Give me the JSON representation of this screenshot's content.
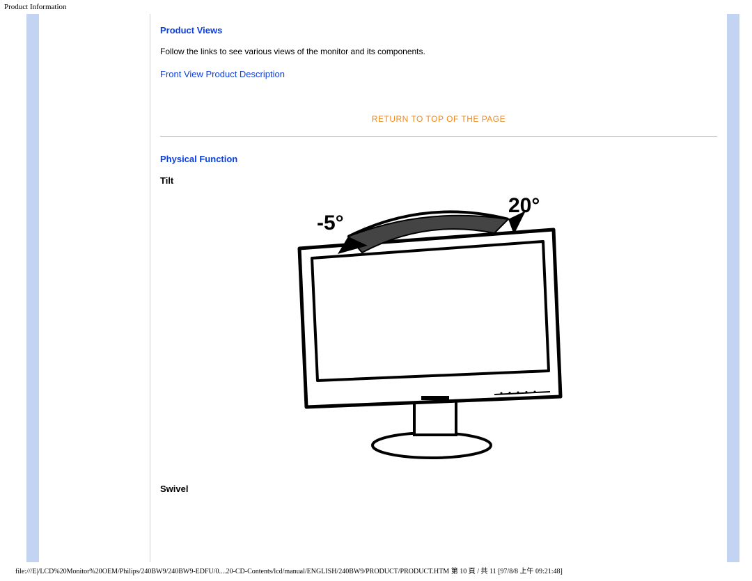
{
  "header": {
    "title": "Product Information"
  },
  "sections": {
    "views": {
      "heading": "Product Views",
      "text": "Follow the links to see various views of the monitor and its components.",
      "link": "Front View Product Description"
    },
    "returnTop": "RETURN TO TOP OF THE PAGE",
    "physical": {
      "heading": "Physical Function",
      "tiltLabel": "Tilt",
      "swivelLabel": "Swivel",
      "angles": {
        "back": "-5°",
        "forward": "20°"
      }
    }
  },
  "footer": {
    "path": "file:///E|/LCD%20Monitor%20OEM/Philips/240BW9/240BW9-EDFU/0....20-CD-Contents/lcd/manual/ENGLISH/240BW9/PRODUCT/PRODUCT.HTM 第 10 頁 / 共 11  [97/8/8 上午 09:21:48]"
  }
}
